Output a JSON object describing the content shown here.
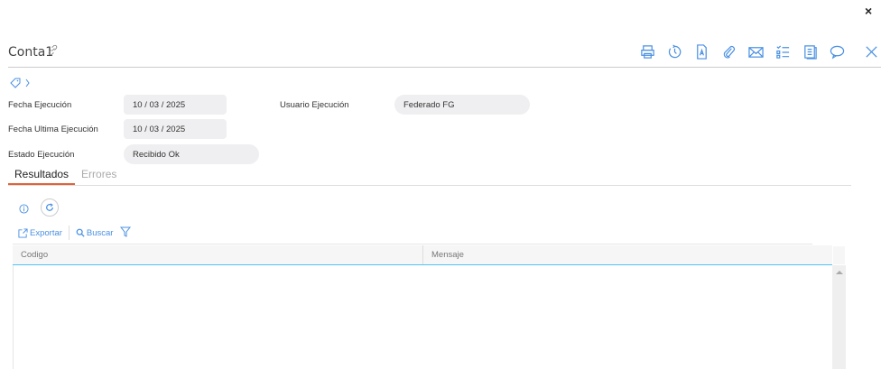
{
  "window": {
    "close_label": "×"
  },
  "header": {
    "title": "Conta1"
  },
  "fields": {
    "fecha_ejecucion": {
      "label": "Fecha Ejecución",
      "day": "10",
      "month": "03",
      "year": "2025"
    },
    "fecha_ultima": {
      "label": "Fecha Ultima Ejecución",
      "day": "10",
      "month": "03",
      "year": "2025"
    },
    "estado": {
      "label": "Estado Ejecución",
      "value": "Recibido Ok"
    },
    "usuario": {
      "label": "Usuario Ejecución",
      "value": "Federado FG"
    }
  },
  "date_sep": "/",
  "tabs": [
    {
      "label": "Resultados"
    },
    {
      "label": "Errores"
    }
  ],
  "actions": {
    "export": "Exportar",
    "search": "Buscar"
  },
  "grid": {
    "columns": [
      "Codigo",
      "Mensaje"
    ]
  },
  "colors": {
    "accent": "#4a90e2",
    "tab_active": "#e2623a",
    "grid_line": "#4fc3f7"
  }
}
